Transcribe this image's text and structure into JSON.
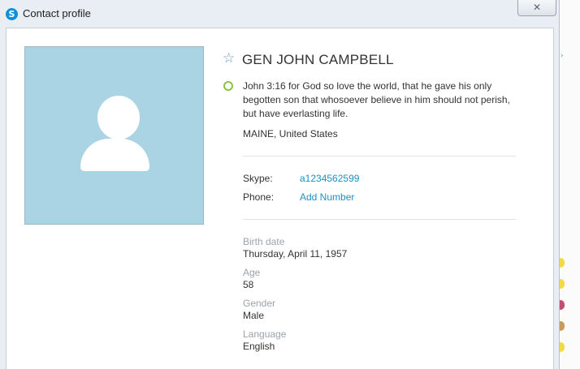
{
  "window": {
    "title": "Contact profile",
    "close_glyph": "✕",
    "app_icon_letter": "S",
    "app_icon_name": "skype-icon",
    "accent_color": "#0f8fd8"
  },
  "profile": {
    "name": "GEN JOHN CAMPBELL",
    "favorite_icon": "star-outline",
    "status_icon": "status-circle",
    "status_color": "#8bc43f",
    "mood_message": "John 3:16 for God so love the world, that he gave his only begotten son that whosoever believe in him should not perish, but have everlasting life.",
    "location": "MAINE, United States",
    "avatar_bg_color": "#aad4e3"
  },
  "contact": {
    "skype_label": "Skype:",
    "skype_value": "a1234562599",
    "phone_label": "Phone:",
    "phone_value": "Add Number",
    "link_color": "#1a92c8"
  },
  "details": {
    "birth_date_label": "Birth date",
    "birth_date_value": "Thursday, April 11, 1957",
    "age_label": "Age",
    "age_value": "58",
    "gender_label": "Gender",
    "gender_value": "Male",
    "language_label": "Language",
    "language_value": "English"
  }
}
